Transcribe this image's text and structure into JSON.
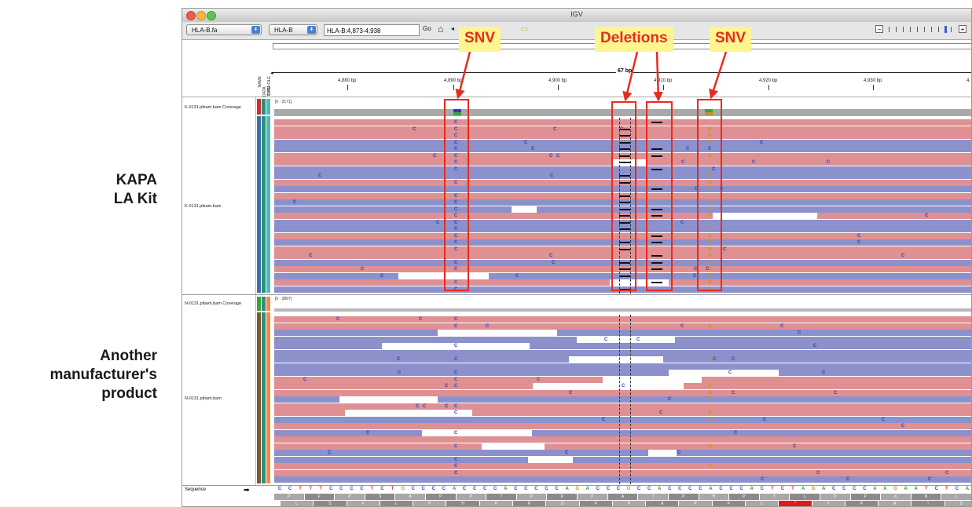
{
  "side_labels": {
    "kapa": [
      "KAPA",
      "LA Kit"
    ],
    "other": [
      "Another",
      "manufacturer's",
      "product"
    ]
  },
  "window": {
    "title": "IGV"
  },
  "toolbar": {
    "genome": "HLA-B.fa",
    "chromosome": "HLA-B",
    "locus": "HLA-B:4,873-4,938",
    "go_label": "Go",
    "home_icon": "home-icon"
  },
  "ruler": {
    "span": "67 bp",
    "ticks": [
      "4,880 bp",
      "4,890 bp",
      "4,900 bp",
      "4,910 bp",
      "4,920 bp",
      "4,930 bp",
      "4,"
    ]
  },
  "attribute_labels": [
    "NAME",
    "DATA TYPE",
    "DATA FILE"
  ],
  "tracks": {
    "kapa_coverage": {
      "name": "K-0131.pibam.bam Coverage",
      "range": "[0 - 2171]"
    },
    "kapa_alignments": {
      "name": "K-0131.pibam.bam"
    },
    "other_coverage": {
      "name": "N-0131.pibam.bam Coverage",
      "range": "[0 - 3897]"
    },
    "other_alignments": {
      "name": "N-0131.pibam.bam"
    },
    "sequence": {
      "name": "Sequence",
      "strand_arrow": "➡"
    }
  },
  "sequence_bases": "CCTTTCCCCTCTGCCCCACCCCACCCCCAGACCCGCCACCCCACCCACTCTAGACCCCAAGAATCTCA",
  "translation_row1": [
    "P",
    "F",
    "P",
    "S",
    "A",
    "P",
    "P",
    "T",
    "P",
    "K",
    "P",
    "A",
    "T",
    "P",
    "H",
    "P",
    "T",
    "L",
    "D",
    "P",
    "K",
    "N",
    "L"
  ],
  "translation_row2": [
    "L",
    "S",
    "F",
    "L",
    "P",
    "H",
    "P",
    "P",
    "D",
    "P",
    "P",
    "A",
    "P",
    "P",
    "L",
    "*",
    "T",
    "P",
    "R",
    "I",
    "S"
  ],
  "annotations": {
    "snv_left": "SNV",
    "deletions": "Deletions",
    "snv_right": "SNV"
  },
  "colors": {
    "forward_read": "#8c91cc",
    "reverse_read": "#df9092",
    "annotation_box": "#e52d1d",
    "callout_bg": "#fef590"
  }
}
